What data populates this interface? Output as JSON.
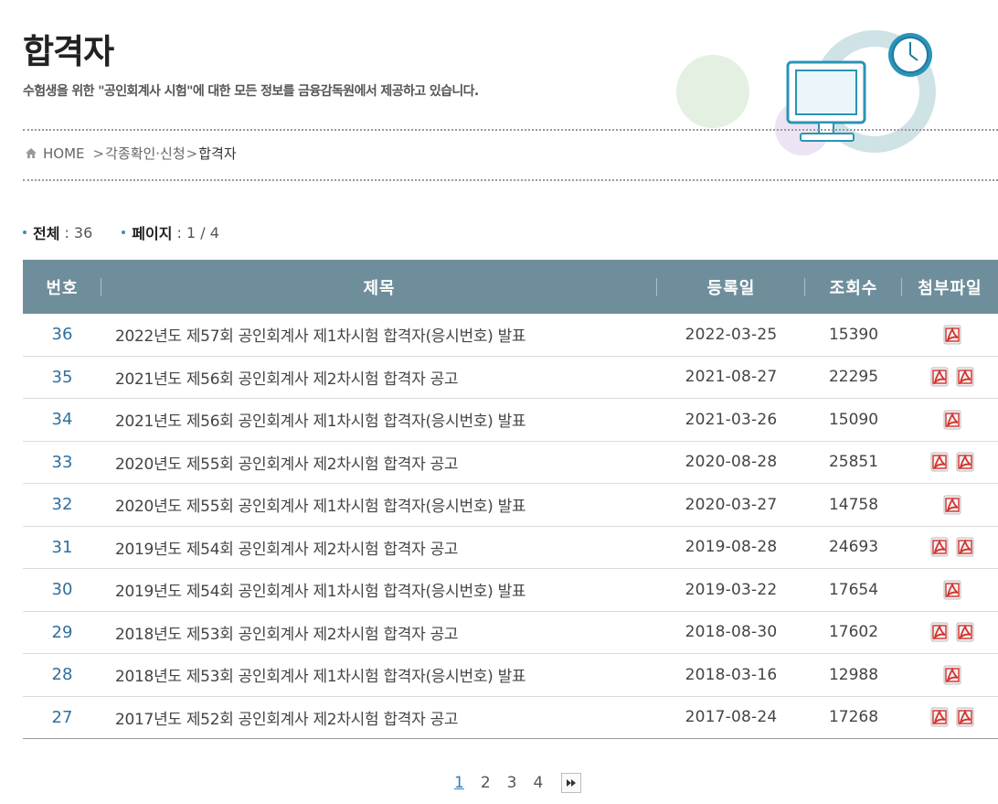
{
  "header": {
    "title": "합격자",
    "description": "수험생을 위한 \"공인회계사 시험\"에 대한 모든 정보를 금융감독원에서 제공하고 있습니다."
  },
  "breadcrumb": {
    "home": "HOME",
    "sep1": ">",
    "level1": "각종확인·신청",
    "sep2": ">",
    "current": "합격자"
  },
  "summary": {
    "total_label": "전체",
    "total_value": ": 36",
    "page_label": "페이지",
    "page_value": ": 1 / 4"
  },
  "table": {
    "headers": [
      "번호",
      "제목",
      "등록일",
      "조회수",
      "첨부파일"
    ],
    "rows": [
      {
        "no": "36",
        "title": "2022년도 제57회 공인회계사 제1차시험 합격자(응시번호) 발표",
        "date": "2022-03-25",
        "views": "15390",
        "files": 1
      },
      {
        "no": "35",
        "title": "2021년도 제56회 공인회계사 제2차시험 합격자 공고",
        "date": "2021-08-27",
        "views": "22295",
        "files": 2
      },
      {
        "no": "34",
        "title": "2021년도 제56회 공인회계사 제1차시험 합격자(응시번호) 발표",
        "date": "2021-03-26",
        "views": "15090",
        "files": 1
      },
      {
        "no": "33",
        "title": "2020년도 제55회 공인회계사 제2차시험 합격자 공고",
        "date": "2020-08-28",
        "views": "25851",
        "files": 2
      },
      {
        "no": "32",
        "title": "2020년도 제55회 공인회계사 제1차시험 합격자(응시번호) 발표",
        "date": "2020-03-27",
        "views": "14758",
        "files": 1
      },
      {
        "no": "31",
        "title": "2019년도 제54회 공인회계사 제2차시험 합격자 공고",
        "date": "2019-08-28",
        "views": "24693",
        "files": 2
      },
      {
        "no": "30",
        "title": "2019년도 제54회 공인회계사 제1차시험 합격자(응시번호) 발표",
        "date": "2019-03-22",
        "views": "17654",
        "files": 1
      },
      {
        "no": "29",
        "title": "2018년도 제53회 공인회계사 제2차시험 합격자 공고",
        "date": "2018-08-30",
        "views": "17602",
        "files": 2
      },
      {
        "no": "28",
        "title": "2018년도 제53회 공인회계사 제1차시험 합격자(응시번호) 발표",
        "date": "2018-03-16",
        "views": "12988",
        "files": 1
      },
      {
        "no": "27",
        "title": "2017년도 제52회 공인회계사 제2차시험 합격자 공고",
        "date": "2017-08-24",
        "views": "17268",
        "files": 2
      }
    ]
  },
  "pagination": {
    "pages": [
      "1",
      "2",
      "3",
      "4"
    ],
    "current": "1"
  },
  "icons": {
    "home": "home-icon",
    "attachment": "pdf-file-icon",
    "next": "fast-forward-icon",
    "decoration": "computer-clock-illustration"
  },
  "colors": {
    "header_bar": "#6f8e9b",
    "link_blue": "#2f6f9f",
    "pdf_red": "#d4302b"
  }
}
